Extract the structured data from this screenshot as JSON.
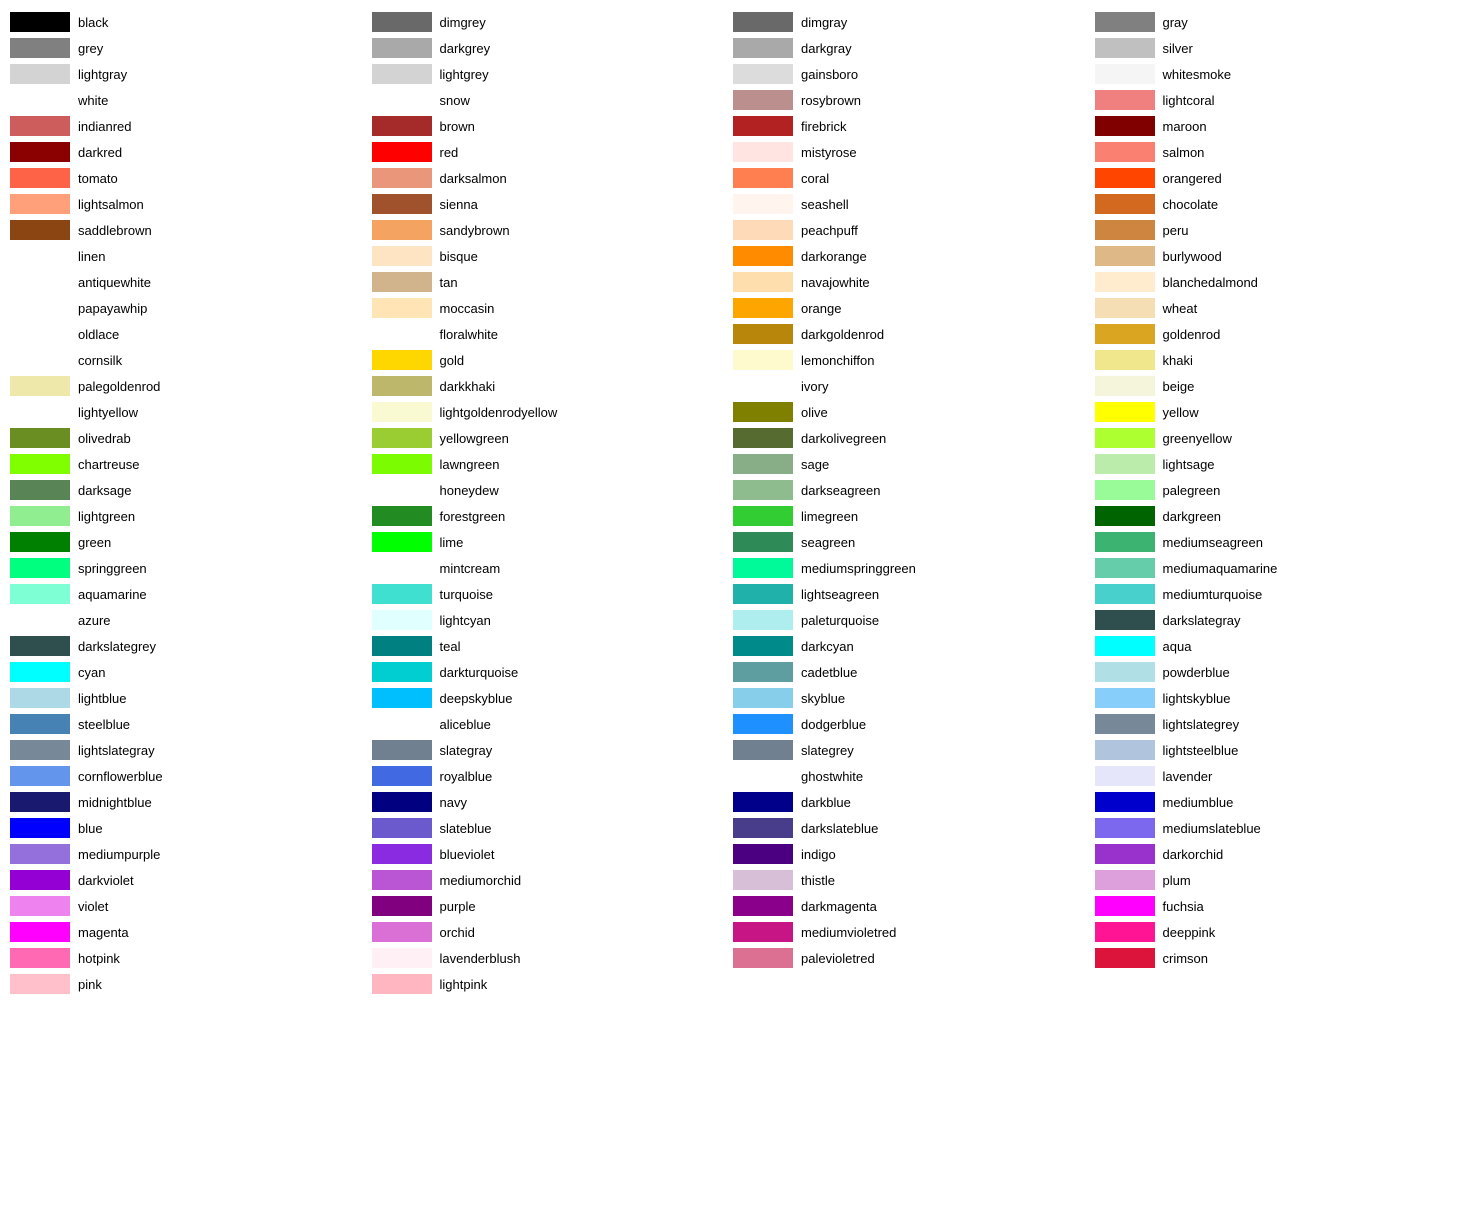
{
  "columns": [
    {
      "id": "col1",
      "items": [
        {
          "name": "black",
          "color": "#000000"
        },
        {
          "name": "grey",
          "color": "#808080"
        },
        {
          "name": "lightgray",
          "color": "#d3d3d3"
        },
        {
          "name": "white",
          "color": null
        },
        {
          "name": "indianred",
          "color": "#cd5c5c"
        },
        {
          "name": "darkred",
          "color": "#8b0000"
        },
        {
          "name": "tomato",
          "color": "#ff6347"
        },
        {
          "name": "lightsalmon",
          "color": "#ffa07a"
        },
        {
          "name": "saddlebrown",
          "color": "#8b4513"
        },
        {
          "name": "linen",
          "color": null
        },
        {
          "name": "antiquewhite",
          "color": null
        },
        {
          "name": "papayawhip",
          "color": null
        },
        {
          "name": "oldlace",
          "color": null
        },
        {
          "name": "cornsilk",
          "color": null
        },
        {
          "name": "palegoldenrod",
          "color": "#eee8aa"
        },
        {
          "name": "lightyellow",
          "color": null
        },
        {
          "name": "olivedrab",
          "color": "#6b8e23"
        },
        {
          "name": "chartreuse",
          "color": "#7fff00"
        },
        {
          "name": "darksage",
          "color": "#598556"
        },
        {
          "name": "lightgreen",
          "color": "#90ee90"
        },
        {
          "name": "green",
          "color": "#008000"
        },
        {
          "name": "springgreen",
          "color": "#00ff7f"
        },
        {
          "name": "aquamarine",
          "color": "#7fffd4"
        },
        {
          "name": "azure",
          "color": null
        },
        {
          "name": "darkslategrey",
          "color": "#2f4f4f"
        },
        {
          "name": "cyan",
          "color": "#00ffff"
        },
        {
          "name": "lightblue",
          "color": "#add8e6"
        },
        {
          "name": "steelblue",
          "color": "#4682b4"
        },
        {
          "name": "lightslategray",
          "color": "#778899"
        },
        {
          "name": "cornflowerblue",
          "color": "#6495ed"
        },
        {
          "name": "midnightblue",
          "color": "#191970"
        },
        {
          "name": "blue",
          "color": "#0000ff"
        },
        {
          "name": "mediumpurple",
          "color": "#9370db"
        },
        {
          "name": "darkviolet",
          "color": "#9400d3"
        },
        {
          "name": "violet",
          "color": "#ee82ee"
        },
        {
          "name": "magenta",
          "color": "#ff00ff"
        },
        {
          "name": "hotpink",
          "color": "#ff69b4"
        },
        {
          "name": "pink",
          "color": "#ffc0cb"
        }
      ]
    },
    {
      "id": "col2",
      "items": [
        {
          "name": "dimgrey",
          "color": "#696969"
        },
        {
          "name": "darkgrey",
          "color": "#a9a9a9"
        },
        {
          "name": "lightgrey",
          "color": "#d3d3d3"
        },
        {
          "name": "snow",
          "color": null
        },
        {
          "name": "brown",
          "color": "#a52a2a"
        },
        {
          "name": "red",
          "color": "#ff0000"
        },
        {
          "name": "darksalmon",
          "color": "#e9967a"
        },
        {
          "name": "sienna",
          "color": "#a0522d"
        },
        {
          "name": "sandybrown",
          "color": "#f4a460"
        },
        {
          "name": "bisque",
          "color": "#ffe4c4"
        },
        {
          "name": "tan",
          "color": "#d2b48c"
        },
        {
          "name": "moccasin",
          "color": "#ffe4b5"
        },
        {
          "name": "floralwhite",
          "color": null
        },
        {
          "name": "gold",
          "color": "#ffd700"
        },
        {
          "name": "darkkhaki",
          "color": "#bdb76b"
        },
        {
          "name": "lightgoldenrodyellow",
          "color": "#fafad2"
        },
        {
          "name": "yellowgreen",
          "color": "#9acd32"
        },
        {
          "name": "lawngreen",
          "color": "#7cfc00"
        },
        {
          "name": "honeydew",
          "color": null
        },
        {
          "name": "forestgreen",
          "color": "#228b22"
        },
        {
          "name": "lime",
          "color": "#00ff00"
        },
        {
          "name": "mintcream",
          "color": null
        },
        {
          "name": "turquoise",
          "color": "#40e0d0"
        },
        {
          "name": "lightcyan",
          "color": "#e0ffff"
        },
        {
          "name": "teal",
          "color": "#008080"
        },
        {
          "name": "darkturquoise",
          "color": "#00ced1"
        },
        {
          "name": "deepskyblue",
          "color": "#00bfff"
        },
        {
          "name": "aliceblue",
          "color": null
        },
        {
          "name": "slategray",
          "color": "#708090"
        },
        {
          "name": "royalblue",
          "color": "#4169e1"
        },
        {
          "name": "navy",
          "color": "#000080"
        },
        {
          "name": "slateblue",
          "color": "#6a5acd"
        },
        {
          "name": "blueviolet",
          "color": "#8a2be2"
        },
        {
          "name": "mediumorchid",
          "color": "#ba55d3"
        },
        {
          "name": "purple",
          "color": "#800080"
        },
        {
          "name": "orchid",
          "color": "#da70d6"
        },
        {
          "name": "lavenderblush",
          "color": "#fff0f5"
        },
        {
          "name": "lightpink",
          "color": "#ffb6c1"
        }
      ]
    },
    {
      "id": "col3",
      "items": [
        {
          "name": "dimgray",
          "color": "#696969"
        },
        {
          "name": "darkgray",
          "color": "#a9a9a9"
        },
        {
          "name": "gainsboro",
          "color": "#dcdcdc"
        },
        {
          "name": "rosybrown",
          "color": "#bc8f8f"
        },
        {
          "name": "firebrick",
          "color": "#b22222"
        },
        {
          "name": "mistyrose",
          "color": "#ffe4e1"
        },
        {
          "name": "coral",
          "color": "#ff7f50"
        },
        {
          "name": "seashell",
          "color": "#fff5ee"
        },
        {
          "name": "peachpuff",
          "color": "#ffdab9"
        },
        {
          "name": "darkorange",
          "color": "#ff8c00"
        },
        {
          "name": "navajowhite",
          "color": "#ffdead"
        },
        {
          "name": "orange",
          "color": "#ffa500"
        },
        {
          "name": "darkgoldenrod",
          "color": "#b8860b"
        },
        {
          "name": "lemonchiffon",
          "color": "#fffacd"
        },
        {
          "name": "ivory",
          "color": null
        },
        {
          "name": "olive",
          "color": "#808000"
        },
        {
          "name": "darkolivegreen",
          "color": "#556b2f"
        },
        {
          "name": "sage",
          "color": "#87ae86"
        },
        {
          "name": "darkseagreen",
          "color": "#8fbc8f"
        },
        {
          "name": "limegreen",
          "color": "#32cd32"
        },
        {
          "name": "seagreen",
          "color": "#2e8b57"
        },
        {
          "name": "mediumspringgreen",
          "color": "#00fa9a"
        },
        {
          "name": "lightseagreen",
          "color": "#20b2aa"
        },
        {
          "name": "paleturquoise",
          "color": "#afeeee"
        },
        {
          "name": "darkcyan",
          "color": "#008b8b"
        },
        {
          "name": "cadetblue",
          "color": "#5f9ea0"
        },
        {
          "name": "skyblue",
          "color": "#87ceeb"
        },
        {
          "name": "dodgerblue",
          "color": "#1e90ff"
        },
        {
          "name": "slategrey",
          "color": "#708090"
        },
        {
          "name": "ghostwhite",
          "color": null
        },
        {
          "name": "darkblue",
          "color": "#00008b"
        },
        {
          "name": "darkslateblue",
          "color": "#483d8b"
        },
        {
          "name": "indigo",
          "color": "#4b0082"
        },
        {
          "name": "thistle",
          "color": "#d8bfd8"
        },
        {
          "name": "darkmagenta",
          "color": "#8b008b"
        },
        {
          "name": "mediumvioletred",
          "color": "#c71585"
        },
        {
          "name": "palevioletred",
          "color": "#db7093"
        }
      ]
    },
    {
      "id": "col4",
      "items": [
        {
          "name": "gray",
          "color": "#808080"
        },
        {
          "name": "silver",
          "color": "#c0c0c0"
        },
        {
          "name": "whitesmoke",
          "color": "#f5f5f5"
        },
        {
          "name": "lightcoral",
          "color": "#f08080"
        },
        {
          "name": "maroon",
          "color": "#800000"
        },
        {
          "name": "salmon",
          "color": "#fa8072"
        },
        {
          "name": "orangered",
          "color": "#ff4500"
        },
        {
          "name": "chocolate",
          "color": "#d2691e"
        },
        {
          "name": "peru",
          "color": "#cd853f"
        },
        {
          "name": "burlywood",
          "color": "#deb887"
        },
        {
          "name": "blanchedalmond",
          "color": "#ffebcd"
        },
        {
          "name": "wheat",
          "color": "#f5deb3"
        },
        {
          "name": "goldenrod",
          "color": "#daa520"
        },
        {
          "name": "khaki",
          "color": "#f0e68c"
        },
        {
          "name": "beige",
          "color": "#f5f5dc"
        },
        {
          "name": "yellow",
          "color": "#ffff00"
        },
        {
          "name": "greenyellow",
          "color": "#adff2f"
        },
        {
          "name": "lightsage",
          "color": "#bcecac"
        },
        {
          "name": "palegreen",
          "color": "#98fb98"
        },
        {
          "name": "darkgreen",
          "color": "#006400"
        },
        {
          "name": "mediumseagreen",
          "color": "#3cb371"
        },
        {
          "name": "mediumaquamarine",
          "color": "#66cdaa"
        },
        {
          "name": "mediumturquoise",
          "color": "#48d1cc"
        },
        {
          "name": "darkslategray",
          "color": "#2f4f4f"
        },
        {
          "name": "aqua",
          "color": "#00ffff"
        },
        {
          "name": "powderblue",
          "color": "#b0e0e6"
        },
        {
          "name": "lightskyblue",
          "color": "#87cefa"
        },
        {
          "name": "lightslategrey",
          "color": "#778899"
        },
        {
          "name": "lightsteelblue",
          "color": "#b0c4de"
        },
        {
          "name": "lavender",
          "color": "#e6e6fa"
        },
        {
          "name": "mediumblue",
          "color": "#0000cd"
        },
        {
          "name": "mediumslateblue",
          "color": "#7b68ee"
        },
        {
          "name": "darkorchid",
          "color": "#9932cc"
        },
        {
          "name": "plum",
          "color": "#dda0dd"
        },
        {
          "name": "fuchsia",
          "color": "#ff00ff"
        },
        {
          "name": "deeppink",
          "color": "#ff1493"
        },
        {
          "name": "crimson",
          "color": "#dc143c"
        }
      ]
    }
  ]
}
